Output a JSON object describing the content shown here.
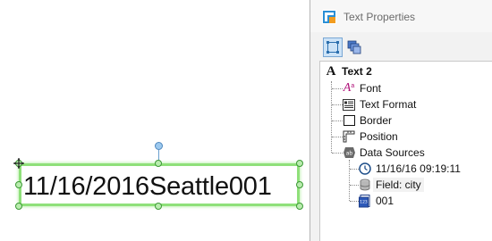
{
  "canvas": {
    "text_object_value": "11/16/2016Seattle001"
  },
  "panel": {
    "title": "Text Properties",
    "toolbar": {
      "layout_icon": "object-layout-icon",
      "layers_icon": "layers-icon"
    },
    "tree": {
      "root_label": "Text 2",
      "items": [
        {
          "label": "Font",
          "icon": "font-icon"
        },
        {
          "label": "Text Format",
          "icon": "text-format-icon"
        },
        {
          "label": "Border",
          "icon": "border-icon"
        },
        {
          "label": "Position",
          "icon": "position-ruler-icon"
        },
        {
          "label": "Data Sources",
          "icon": "data-sources-icon"
        }
      ],
      "data_sources": [
        {
          "label": "11/16/16 09:19:11",
          "icon": "clock-icon"
        },
        {
          "label": "Field: city",
          "icon": "database-icon"
        },
        {
          "label": "001",
          "icon": "serial-number-icon"
        }
      ]
    }
  },
  "colors": {
    "selection_green": "#8fe07a",
    "rotate_handle_blue": "#9cc9ef",
    "toolbar_active": "#cde3f7"
  }
}
